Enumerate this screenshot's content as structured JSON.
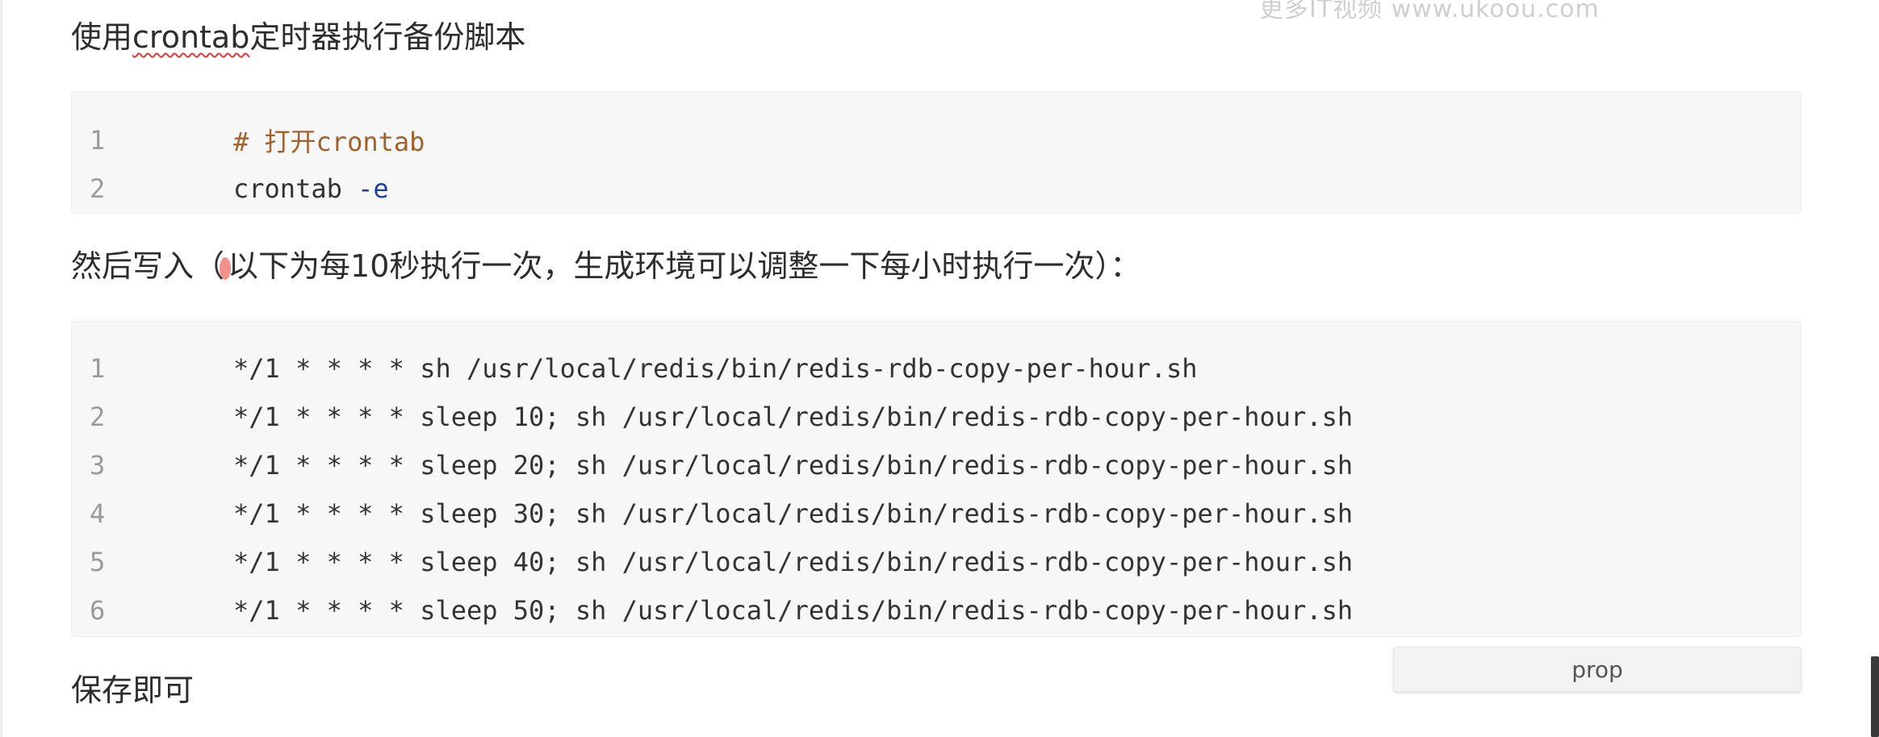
{
  "watermark": "更多IT视频 www.ukoou.com",
  "paragraphs": {
    "p1_before": "使用",
    "p1_keyword": "crontab",
    "p1_after": "定时器执行备份脚本",
    "p2_before": "然后写入（",
    "p2_after": "以下为每10秒执行一次，生成环境可以调整一下每小时执行一次）：",
    "p3": "保存即可"
  },
  "code_block_1": {
    "lines": [
      {
        "no": "1",
        "comment": "# 打开crontab"
      },
      {
        "no": "2",
        "cmd": "crontab ",
        "flag": "-e"
      }
    ]
  },
  "code_block_2": {
    "lines": [
      {
        "no": "1",
        "text": "*/1 * * * * sh /usr/local/redis/bin/redis-rdb-copy-per-hour.sh"
      },
      {
        "no": "2",
        "text": "*/1 * * * * sleep 10; sh /usr/local/redis/bin/redis-rdb-copy-per-hour.sh"
      },
      {
        "no": "3",
        "text": "*/1 * * * * sleep 20; sh /usr/local/redis/bin/redis-rdb-copy-per-hour.sh"
      },
      {
        "no": "4",
        "text": "*/1 * * * * sleep 30; sh /usr/local/redis/bin/redis-rdb-copy-per-hour.sh"
      },
      {
        "no": "5",
        "text": "*/1 * * * * sleep 40; sh /usr/local/redis/bin/redis-rdb-copy-per-hour.sh"
      },
      {
        "no": "6",
        "text": "*/1 * * * * sleep 50; sh /usr/local/redis/bin/redis-rdb-copy-per-hour.sh"
      }
    ]
  },
  "prop_button": {
    "label": "prop"
  },
  "colors": {
    "comment": "#a0622c",
    "flag": "#1f3f9e",
    "line_number": "#9a9a9a",
    "code_background": "#f7f7f7"
  }
}
